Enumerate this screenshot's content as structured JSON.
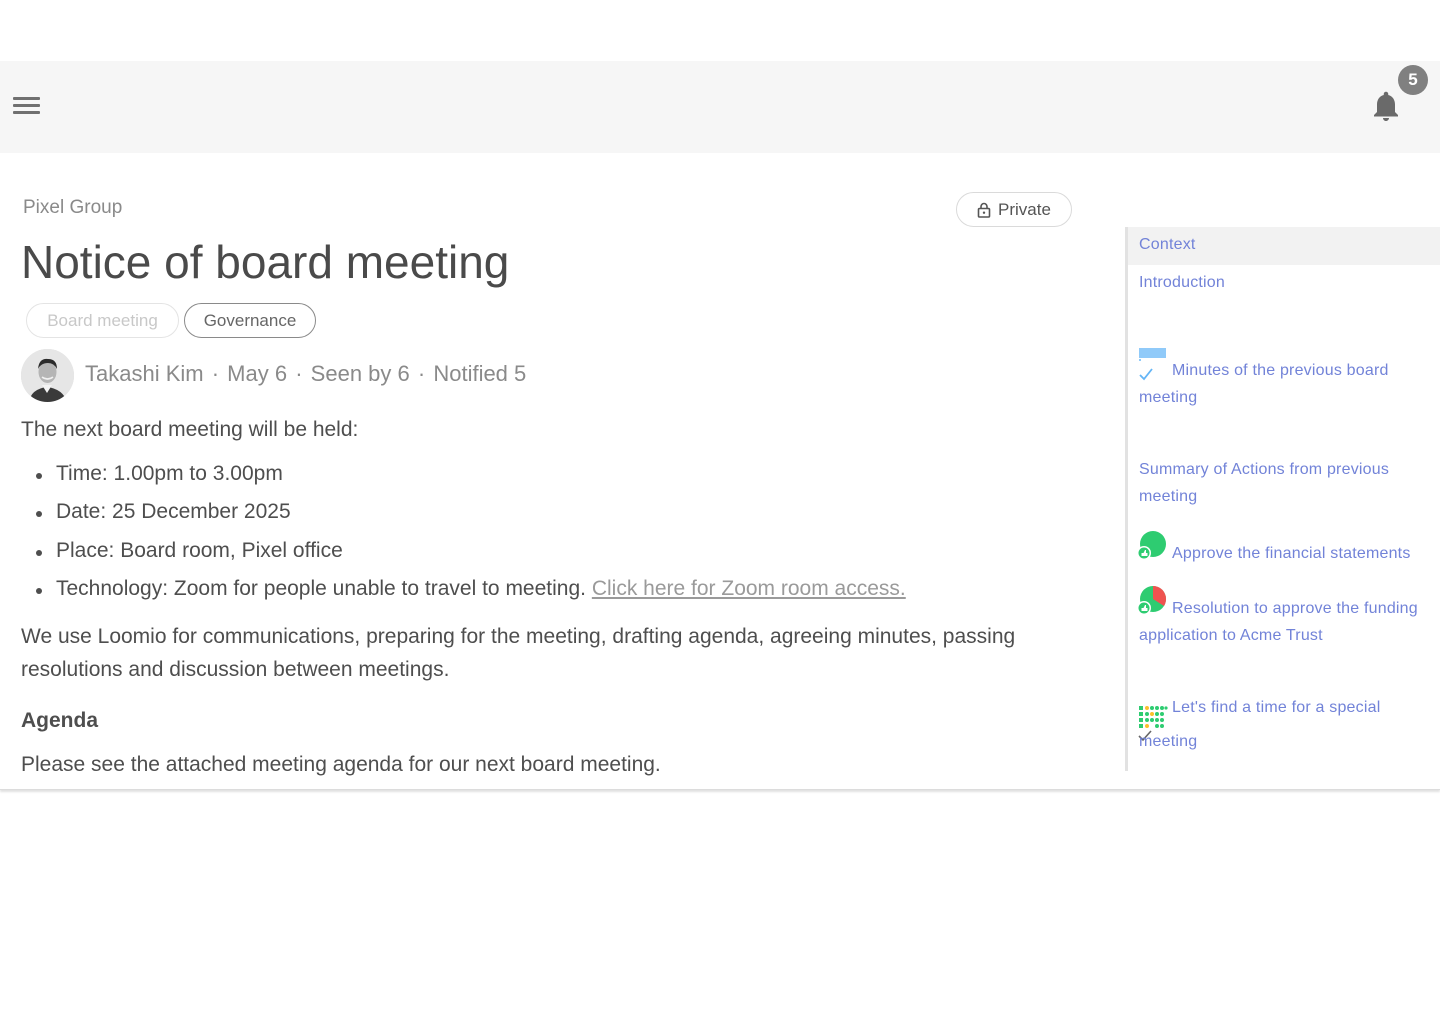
{
  "header": {
    "menu_icon": "hamburger-menu-icon",
    "notifications_icon": "bell-icon",
    "notification_count": "5"
  },
  "thread": {
    "group_name": "Pixel Group",
    "privacy_label": "Private",
    "privacy_icon": "lock-icon",
    "title": "Notice of board meeting",
    "tags": [
      "Board meeting",
      "Governance"
    ],
    "author": "Takashi Kim",
    "date": "May 6",
    "seen": "Seen by 6",
    "notified": "Notified 5",
    "meta_separator": "·"
  },
  "body": {
    "intro": "The next board meeting will be held:",
    "details": [
      "Time: 1.00pm to 3.00pm",
      "Date: 25 December 2025",
      "Place: Board room, Pixel office",
      "Technology: Zoom for people unable to travel to meeting. "
    ],
    "zoom_link": "Click here for Zoom room access.",
    "loomio_paragraph": "We use Loomio for communications, preparing for the meeting, drafting agenda, agreeing minutes, passing resolutions and discussion between meetings.",
    "agenda_heading": "Agenda",
    "agenda_text": "Please see the attached meeting agenda for our next board meeting."
  },
  "toc": {
    "items": [
      {
        "label": "Context",
        "icon": ""
      },
      {
        "label": "Introduction",
        "icon": ""
      },
      {
        "label": "Minutes of the previous board meeting",
        "icon": "checklist-icon"
      },
      {
        "label": "Summary of Actions from previous meeting",
        "icon": ""
      },
      {
        "label": "Approve the financial statements",
        "icon": "proposal-pie-icon"
      },
      {
        "label": "Resolution to approve the funding application to Acme Trust",
        "icon": "proposal-pie-icon"
      },
      {
        "label": "Let's find a time for a special meeting",
        "icon": "time-poll-icon"
      }
    ],
    "find_time_line1": "Let's find a time for a special",
    "find_time_line2": "meeting"
  },
  "colors": {
    "toc_link": "#7283d8",
    "topbar_bg": "#f6f6f6",
    "badge_bg": "#808080",
    "proposal_green": "#2ecc71",
    "proposal_red": "#ef5350"
  }
}
